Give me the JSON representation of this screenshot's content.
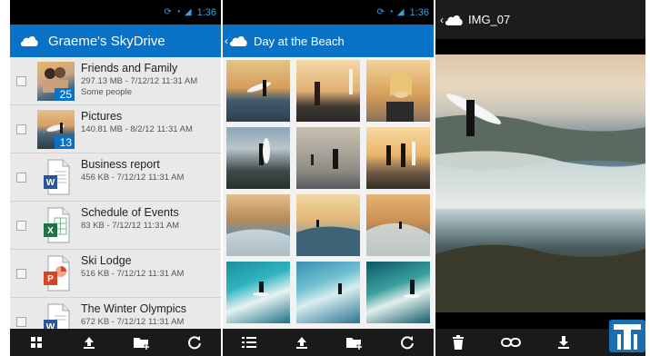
{
  "status_bar": {
    "time": "1:36"
  },
  "panel1": {
    "title": "Graeme's SkyDrive",
    "items": [
      {
        "title": "Friends and Family",
        "meta": "297.13 MB - 7/12/12 11:31 AM",
        "sub": "Some people",
        "count": "25",
        "type": "folder"
      },
      {
        "title": "Pictures",
        "meta": "140.81 MB - 8/2/12 11:31 AM",
        "sub": "",
        "count": "13",
        "type": "folder"
      },
      {
        "title": "Business report",
        "meta": "456 KB - 7/12/12 11:31 AM",
        "sub": "",
        "type": "word"
      },
      {
        "title": "Schedule of Events",
        "meta": "83 KB - 7/12/12 11:31 AM",
        "sub": "",
        "type": "excel"
      },
      {
        "title": "Ski Lodge",
        "meta": "516 KB - 7/12/12 11:31 AM",
        "sub": "",
        "type": "powerpoint"
      },
      {
        "title": "The Winter Olympics",
        "meta": "672 KB - 7/12/12 11:31 AM",
        "sub": "",
        "type": "word"
      }
    ],
    "bottom_icons": [
      "grid-view-icon",
      "upload-icon",
      "new-folder-icon",
      "refresh-icon"
    ]
  },
  "panel2": {
    "title": "Day at the Beach",
    "tiles": 12,
    "bottom_icons": [
      "list-view-icon",
      "upload-icon",
      "new-folder-icon",
      "refresh-icon"
    ]
  },
  "panel3": {
    "title": "IMG_07",
    "bottom_icons": [
      "delete-icon",
      "share-link-icon",
      "download-icon"
    ]
  },
  "colors": {
    "accent": "#0a72c6",
    "word": "#2b579a",
    "excel": "#217346",
    "powerpoint": "#d24726",
    "status": "#39a0df"
  }
}
